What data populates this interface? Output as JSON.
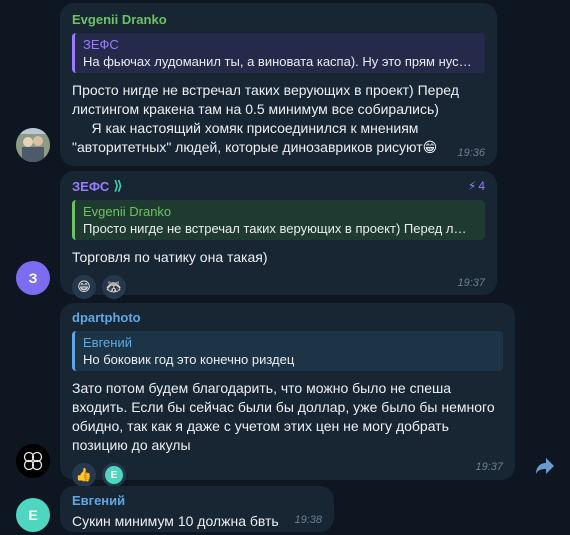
{
  "messages": [
    {
      "sender": "Evgenii Dranko",
      "sender_color": "#6cc264",
      "reply": {
        "name": "ЗЕФС",
        "text": "На фьючах лудоманил ты, а виновата каспа). Ну это прям нус…",
        "color": "#9a7cff"
      },
      "text_lines": [
        "Просто нигде не встречал таких верующих в проект) Перед",
        "листингом кракена там на 0.5 минимум все собирались)",
        "     Я как настоящий хомяк присоединился к мнениям",
        "\"авторитетных\" людей, которые динозавриков рисуют😁"
      ],
      "time": "19:36"
    },
    {
      "sender": "ЗЕФС",
      "sender_color": "#9a7cff",
      "boost_count": "4",
      "reply": {
        "name": "Evgenii Dranko",
        "text": "Просто нигде не встречал таких верующих в проект) Перед л…",
        "color": "#6cc264"
      },
      "text_lines": [
        "Торговля по чатику она такая)"
      ],
      "reactions": [
        "😁",
        "🦝"
      ],
      "avatar_letter": "З",
      "avatar_color": "#7b6cf0",
      "time": "19:37"
    },
    {
      "sender": "dpartphoto",
      "sender_color": "#5ea9e5",
      "reply": {
        "name": "Евгений",
        "text": "Но боковик год это конечно риздец",
        "color": "#5ea9e5"
      },
      "text_lines": [
        "Зато потом будем благодарить, что можно было не спеша",
        "входить. Если бы сейчас были бы доллар, уже было бы немного",
        "обидно, так как я даже с учетом этих цен не могу добрать",
        "позицию до акулы"
      ],
      "reactions": [
        "👍",
        "Е"
      ],
      "time": "19:37"
    },
    {
      "sender": "Евгений",
      "sender_color": "#5ea9e5",
      "text_lines": [
        "Сукин минимум 10 должна бвть"
      ],
      "avatar_letter": "Е",
      "avatar_color": "#4fd6c0",
      "time": "19:38"
    }
  ]
}
